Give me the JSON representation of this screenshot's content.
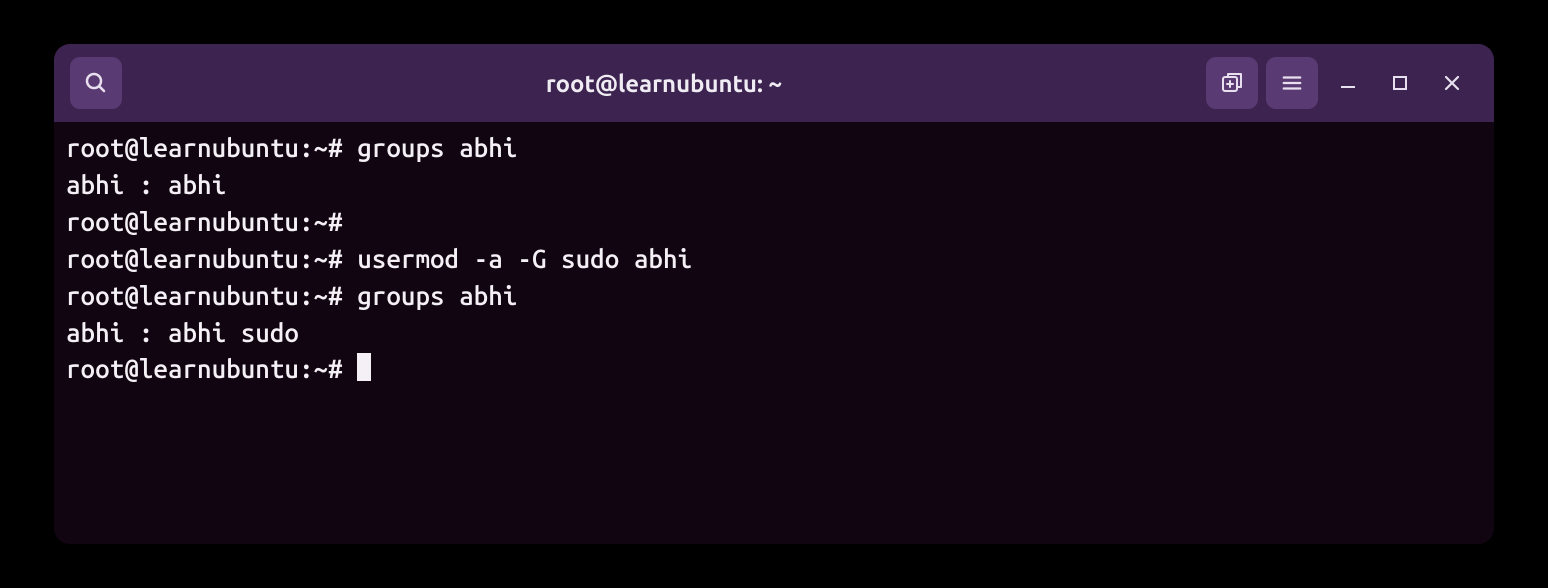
{
  "titlebar": {
    "title": "root@learnubuntu: ~"
  },
  "terminal": {
    "lines": [
      "root@learnubuntu:~# groups abhi",
      "abhi : abhi",
      "root@learnubuntu:~#",
      "root@learnubuntu:~# usermod -a -G sudo abhi",
      "root@learnubuntu:~# groups abhi",
      "abhi : abhi sudo",
      "root@learnubuntu:~# "
    ]
  }
}
